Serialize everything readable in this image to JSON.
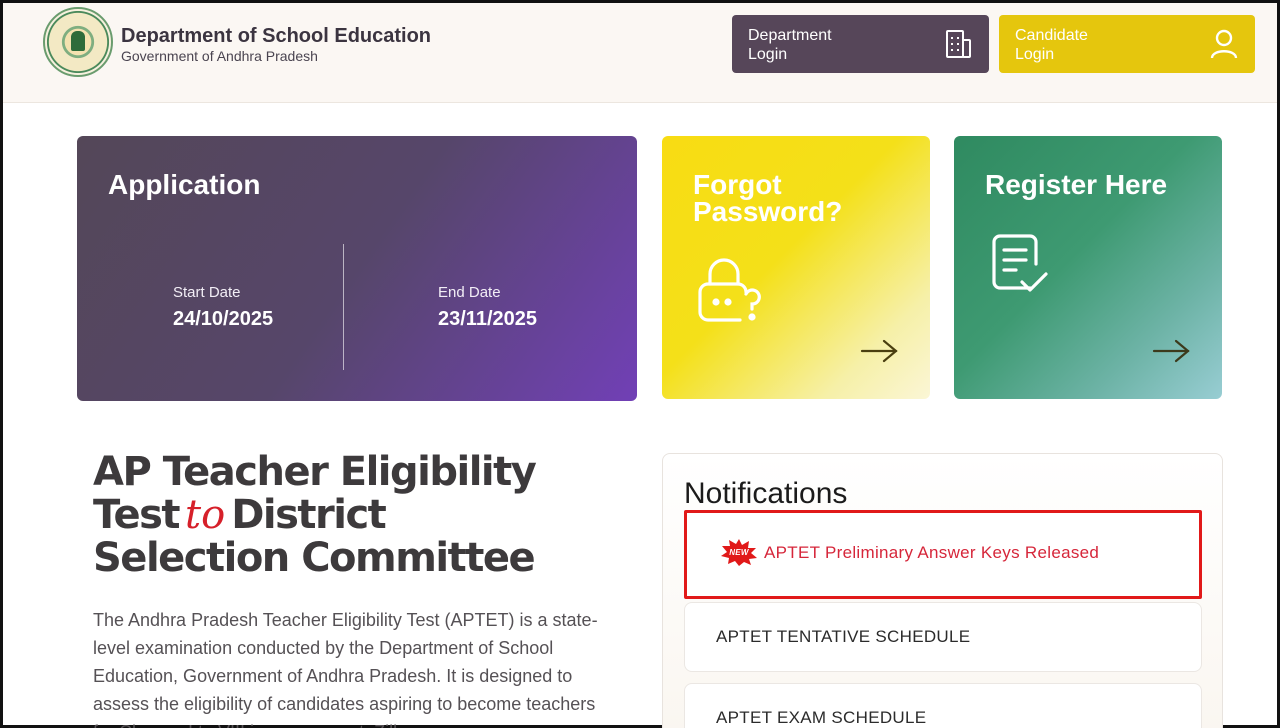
{
  "header": {
    "title": "Department of School Education",
    "subtitle": "Government of Andhra Pradesh",
    "dept_login": [
      "Department",
      "Login"
    ],
    "candidate_login": [
      "Candidate",
      "Login"
    ]
  },
  "cards": {
    "application": {
      "title": "Application",
      "start_label": "Start Date",
      "start_value": "24/10/2025",
      "end_label": "End Date",
      "end_value": "23/11/2025"
    },
    "forgot": {
      "title": [
        "Forgot",
        "Password?"
      ]
    },
    "register": {
      "title": "Register Here"
    }
  },
  "hero": {
    "line1": "AP Teacher Eligibility",
    "line2_a": "Test",
    "line2_accent": "to",
    "line2_b": "District",
    "line3": "Selection Committee",
    "description": "The Andhra Pradesh Teacher Eligibility Test (APTET) is a state-level examination conducted by the Department of School Education, Government of Andhra Pradesh. It is designed to assess the eligibility of candidates aspiring to become teachers for Classes I to VIII in government, Zilla"
  },
  "notifications": {
    "title": "Notifications",
    "items": [
      {
        "label": "APTET Preliminary Answer Keys Released",
        "new": true
      },
      {
        "label": "APTET TENTATIVE SCHEDULE",
        "new": false
      },
      {
        "label": "APTET EXAM SCHEDULE",
        "new": false
      }
    ]
  },
  "colors": {
    "dept_button": "#564659",
    "candidate_button": "#e5c60d",
    "highlight_border": "#e11919",
    "accent_red": "#d6202a"
  },
  "icons": {
    "dept": "building-icon",
    "candidate": "user-icon",
    "forgot": "lock-question-icon",
    "register": "document-check-icon",
    "arrow": "arrow-right-icon",
    "new": "new-badge-icon"
  }
}
